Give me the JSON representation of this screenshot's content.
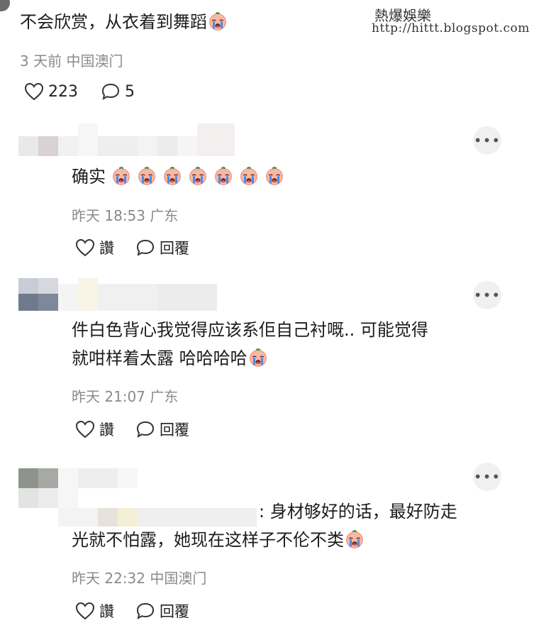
{
  "watermark": {
    "title": "熱爆娛樂",
    "url": "http://hittt.blogspot.com"
  },
  "top_comment": {
    "text": "不会欣赏，从衣着到舞蹈",
    "meta": "3 天前  中国澳门",
    "like_count": "223",
    "reply_count": "5"
  },
  "replies": [
    {
      "text_line1": "确实",
      "emoji_count": 7,
      "meta": "昨天 18:53 广东",
      "like_label": "讚",
      "reply_label": "回覆"
    },
    {
      "text_line1": "件白色背心我觉得应该系佢自己衬嘅.. 可能觉得",
      "text_line2": "就咁样着太露 哈哈哈哈",
      "meta": "昨天 21:07 广东",
      "like_label": "讚",
      "reply_label": "回覆"
    },
    {
      "text_line1": ": 身材够好的话，最好防走",
      "text_line2": "光就不怕露，她现在这样子不伦不类",
      "meta": "昨天 22:32 中国澳门",
      "like_label": "讚",
      "reply_label": "回覆"
    }
  ],
  "more_label": "•••",
  "icons": {
    "like": "heart-outline-icon",
    "reply": "speech-bubble-icon",
    "emoji": "crying-face-emoji-icon",
    "more": "more-dots-icon"
  },
  "colors": {
    "text": "#1c1c1c",
    "meta": "#8a8a8a",
    "more_bg": "#f0f0f0"
  }
}
